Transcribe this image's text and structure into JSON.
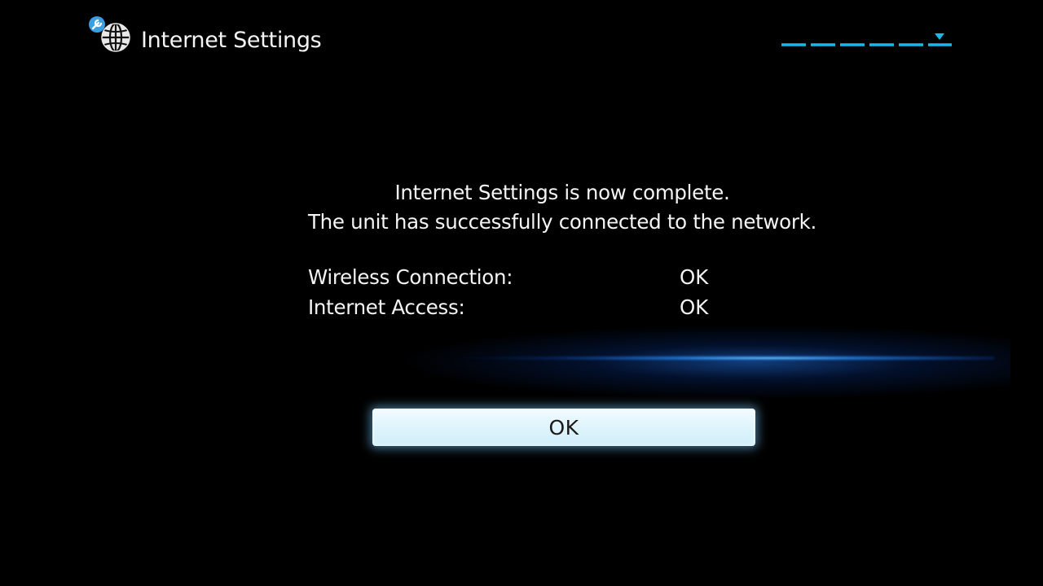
{
  "header": {
    "title": "Internet Settings",
    "icon": "globe-wrench-icon",
    "step_indicator_icon": "step-progress-icon",
    "accent_color": "#1fb6e8"
  },
  "message": {
    "line1": "Internet Settings is now complete.",
    "line2": "The unit has successfully connected to the network."
  },
  "status": [
    {
      "label": "Wireless Connection:",
      "value": "OK"
    },
    {
      "label": "Internet Access:",
      "value": "OK"
    }
  ],
  "ok_button": {
    "label": "OK"
  }
}
